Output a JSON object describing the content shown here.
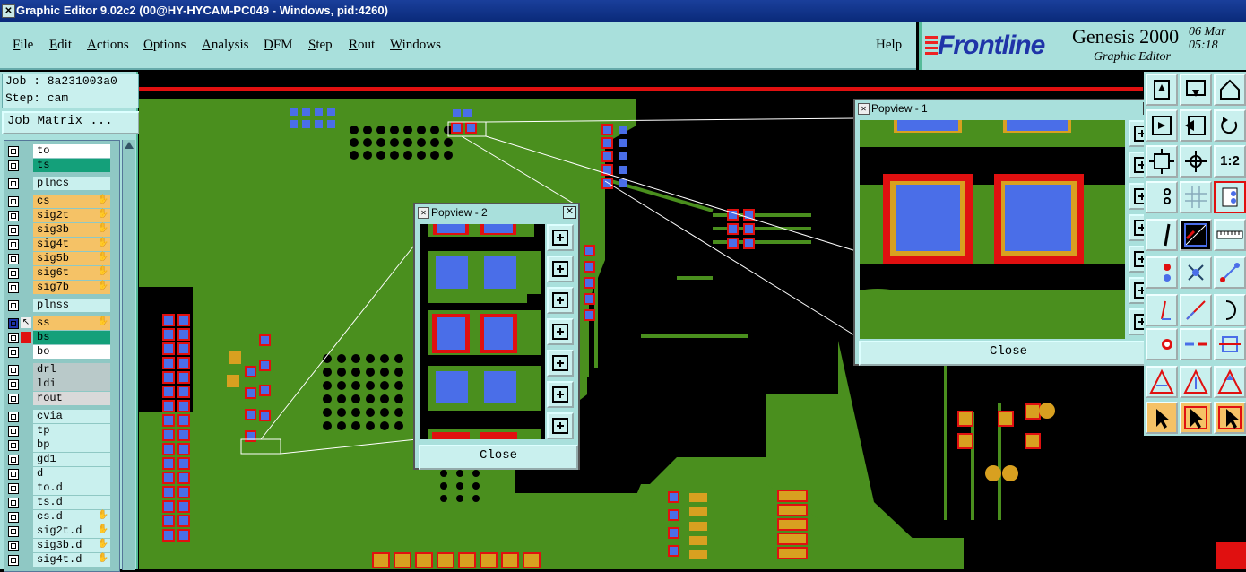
{
  "window": {
    "title": "Graphic Editor 9.02c2 (00@HY-HYCAM-PC049 - Windows, pid:4260)"
  },
  "menu": {
    "items": [
      {
        "first": "F",
        "rest": "ile"
      },
      {
        "first": "E",
        "rest": "dit"
      },
      {
        "first": "A",
        "rest": "ctions"
      },
      {
        "first": "O",
        "rest": "ptions"
      },
      {
        "first": "A",
        "rest": "nalysis"
      },
      {
        "first": "D",
        "rest": "FM"
      },
      {
        "first": "S",
        "rest": "tep"
      },
      {
        "first": "R",
        "rest": "out"
      },
      {
        "first": "W",
        "rest": "indows"
      }
    ],
    "help": "Help"
  },
  "logo": {
    "brand": "Frontline",
    "product": "Genesis 2000",
    "subtitle": "Graphic Editor",
    "date": "06 Mar",
    "time": "05:18"
  },
  "job": {
    "job_line": "Job : 8a231003a0",
    "step_line": "Step: cam",
    "matrix_button": "Job Matrix ..."
  },
  "layers": [
    {
      "name": "to",
      "color": "#ffffff"
    },
    {
      "name": "ts",
      "color": "#14a07a"
    },
    {
      "name": "plncs",
      "color": "#c9f0ee"
    },
    {
      "name": "cs",
      "color": "#f5c266",
      "hand": true
    },
    {
      "name": "sig2t",
      "color": "#f5c266",
      "hand": true
    },
    {
      "name": "sig3b",
      "color": "#f5c266",
      "hand": true
    },
    {
      "name": "sig4t",
      "color": "#f5c266",
      "hand": true
    },
    {
      "name": "sig5b",
      "color": "#f5c266",
      "hand": true
    },
    {
      "name": "sig6t",
      "color": "#f5c266",
      "hand": true
    },
    {
      "name": "sig7b",
      "color": "#f5c266",
      "hand": true
    },
    {
      "name": "plnss",
      "color": "#c9f0ee"
    },
    {
      "name": "ss",
      "color": "#f5c266",
      "hand": true,
      "active": true
    },
    {
      "name": "bs",
      "color": "#14a07a",
      "red": true
    },
    {
      "name": "bo",
      "color": "#ffffff"
    },
    {
      "name": "drl",
      "color": "#b9c9c9"
    },
    {
      "name": "ldi",
      "color": "#b9c9c9"
    },
    {
      "name": "rout",
      "color": "#d9d9d9"
    },
    {
      "name": "cvia",
      "color": "#c9f0ee"
    },
    {
      "name": "tp",
      "color": "#c9f0ee"
    },
    {
      "name": "bp",
      "color": "#c9f0ee"
    },
    {
      "name": "gd1",
      "color": "#c9f0ee"
    },
    {
      "name": "d",
      "color": "#c9f0ee"
    },
    {
      "name": "to.d",
      "color": "#c9f0ee"
    },
    {
      "name": "ts.d",
      "color": "#c9f0ee"
    },
    {
      "name": "cs.d",
      "color": "#c9f0ee",
      "hand": true
    },
    {
      "name": "sig2t.d",
      "color": "#c9f0ee",
      "hand": true
    },
    {
      "name": "sig3b.d",
      "color": "#c9f0ee",
      "hand": true
    },
    {
      "name": "sig4t.d",
      "color": "#c9f0ee",
      "hand": true
    }
  ],
  "popview1": {
    "title": "Popview - 1",
    "close": "Close"
  },
  "popview2": {
    "title": "Popview - 2",
    "close": "Close"
  },
  "right_toolbar": {
    "zoom_label": "1:2"
  },
  "colors": {
    "board_green": "#4a8f1e",
    "pad_blue": "#4a6ee8",
    "pad_red": "#e01010",
    "pad_orange": "#d8a020",
    "panel": "#a9e0dc"
  }
}
